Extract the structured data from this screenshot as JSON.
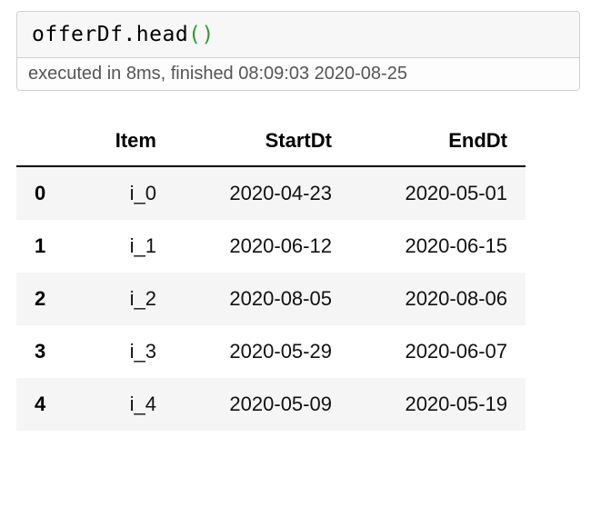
{
  "cell": {
    "code_prefix": "offerDf.head",
    "paren_open": "(",
    "paren_close": ")",
    "exec_status": "executed in 8ms, finished 08:09:03 2020-08-25"
  },
  "dataframe": {
    "index_header": "",
    "columns": [
      "Item",
      "StartDt",
      "EndDt"
    ],
    "rows": [
      {
        "index": "0",
        "cells": [
          "i_0",
          "2020-04-23",
          "2020-05-01"
        ]
      },
      {
        "index": "1",
        "cells": [
          "i_1",
          "2020-06-12",
          "2020-06-15"
        ]
      },
      {
        "index": "2",
        "cells": [
          "i_2",
          "2020-08-05",
          "2020-08-06"
        ]
      },
      {
        "index": "3",
        "cells": [
          "i_3",
          "2020-05-29",
          "2020-06-07"
        ]
      },
      {
        "index": "4",
        "cells": [
          "i_4",
          "2020-05-09",
          "2020-05-19"
        ]
      }
    ]
  }
}
